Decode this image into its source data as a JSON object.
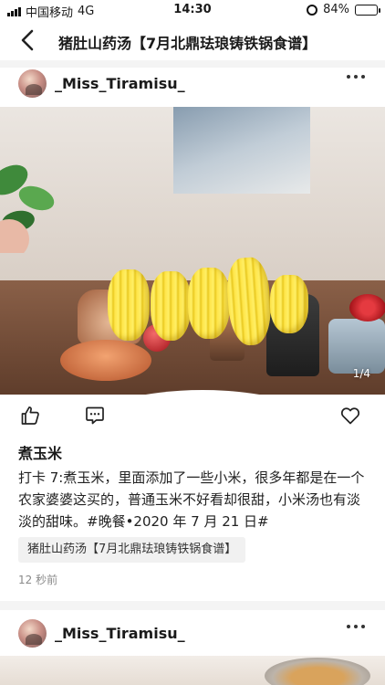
{
  "status_bar": {
    "carrier": "中国移动",
    "network": "4G",
    "time": "14:30",
    "battery": "84%"
  },
  "header": {
    "back_icon": "chevron-left-icon",
    "title": "猪肚山药汤【7月北鼎珐琅铸铁锅食谱】"
  },
  "post": {
    "author": "_Miss_Tiramisu_",
    "more_icon": "ellipsis-icon",
    "photo_counter": "1/4",
    "actions": {
      "like_icon": "thumbs-up-icon",
      "comment_icon": "comment-icon",
      "favorite_icon": "heart-icon"
    },
    "title": "煮玉米",
    "body": "打卡 7:煮玉米，里面添加了一些小米，很多年都是在一个农家婆婆这买的，普通玉米不好看却很甜，小米汤也有淡淡的甜味。#晚餐•2020 年 7 月 21 日#",
    "topic": "猪肚山药汤【7月北鼎珐琅铸铁锅食谱】",
    "time_ago": "12 秒前"
  },
  "next_post": {
    "author": "_Miss_Tiramisu_",
    "more_icon": "ellipsis-icon"
  },
  "colors": {
    "battery_fill": "#35c759",
    "divider": "#f4f4f4",
    "timestamp": "#8a8a8a"
  }
}
